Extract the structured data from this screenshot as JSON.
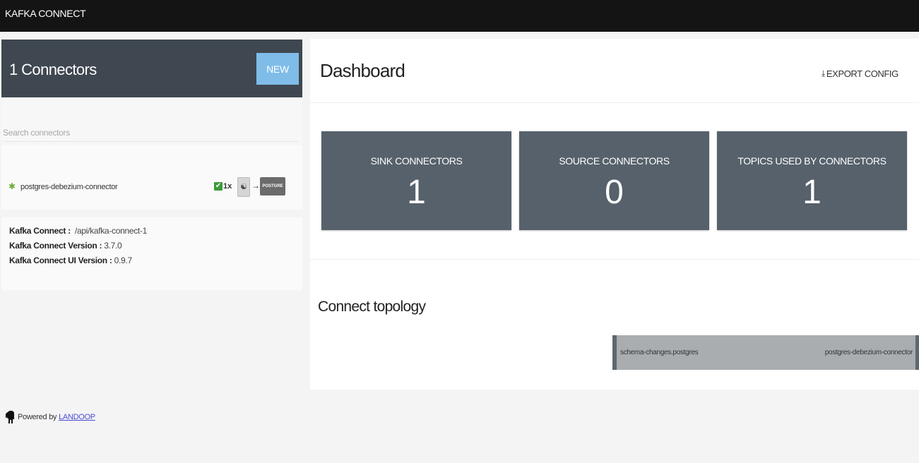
{
  "app": {
    "title": "KAFKA CONNECT"
  },
  "sidebar": {
    "header": {
      "count_label": "1 Connectors",
      "new_button": "NEW"
    },
    "search": {
      "placeholder": "Search connectors",
      "value": ""
    },
    "connectors": [
      {
        "name": "postgres-debezium-connector",
        "status_icon": "gear-icon",
        "status_color": "#6fae3a",
        "running_check": "✔",
        "tasks": "1x",
        "source_icon": "debezium-icon",
        "arrow": "→",
        "target_label": "POSTGRE"
      }
    ],
    "info": {
      "kafka_connect_label": "Kafka Connect :",
      "kafka_connect_value": "/api/kafka-connect-1",
      "version_label": "Kafka Connect Version :",
      "version_value": "3.7.0",
      "ui_version_label": "Kafka Connect UI Version :",
      "ui_version_value": "0.9.7"
    },
    "footer": {
      "powered_by": "Powered by",
      "link": "LANDOOP"
    }
  },
  "dashboard": {
    "title": "Dashboard",
    "export_label": "EXPORT CONFIG",
    "cards": [
      {
        "label": "SINK CONNECTORS",
        "value": "1"
      },
      {
        "label": "SOURCE CONNECTORS",
        "value": "0"
      },
      {
        "label": "TOPICS USED BY CONNECTORS",
        "value": "1"
      }
    ],
    "topology": {
      "title": "Connect topology",
      "topic": "schema-changes.postgres",
      "connector": "postgres-debezium-connector"
    }
  },
  "colors": {
    "topbar": "#141414",
    "header": "#3f4850",
    "accent": "#7fbde8",
    "card": "#56616b",
    "link": "#4a4ad6"
  }
}
